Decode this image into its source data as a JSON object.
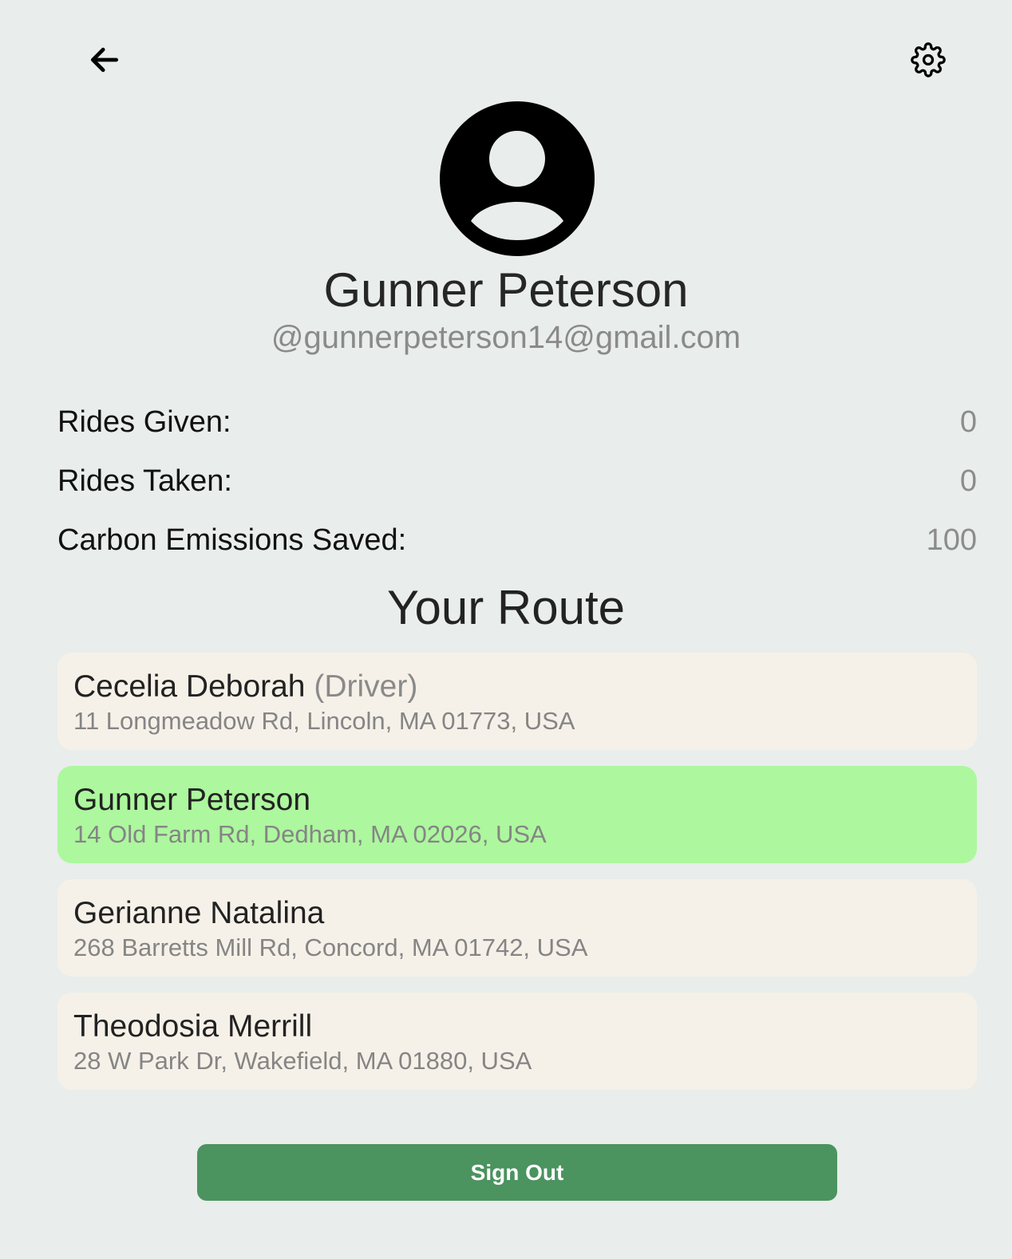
{
  "header": {
    "back_icon": "arrow-left-icon",
    "settings_icon": "gear-icon"
  },
  "profile": {
    "avatar_icon": "user-circle-icon",
    "name": "Gunner Peterson",
    "email": "@gunnerpeterson14@gmail.com"
  },
  "stats": {
    "rides_given_label": "Rides Given:",
    "rides_given_value": "0",
    "rides_taken_label": "Rides Taken:",
    "rides_taken_value": "0",
    "carbon_label": "Carbon Emissions Saved:",
    "carbon_value": "100"
  },
  "route": {
    "title": "Your Route",
    "items": [
      {
        "name": "Cecelia Deborah",
        "role": "(Driver)",
        "address": "11 Longmeadow Rd, Lincoln, MA 01773, USA"
      },
      {
        "name": "Gunner Peterson",
        "role": "",
        "address": "14 Old Farm Rd, Dedham, MA 02026, USA"
      },
      {
        "name": "Gerianne Natalina",
        "role": "",
        "address": "268 Barretts Mill Rd, Concord, MA 01742, USA"
      },
      {
        "name": "Theodosia Merrill",
        "role": "",
        "address": "28 W Park Dr, Wakefield, MA 01880, USA"
      }
    ]
  },
  "actions": {
    "sign_out_label": "Sign Out"
  },
  "colors": {
    "background": "#e9edeb",
    "card": "#f6f1e8",
    "card_highlight": "#adf79e",
    "button": "#4b935f"
  }
}
